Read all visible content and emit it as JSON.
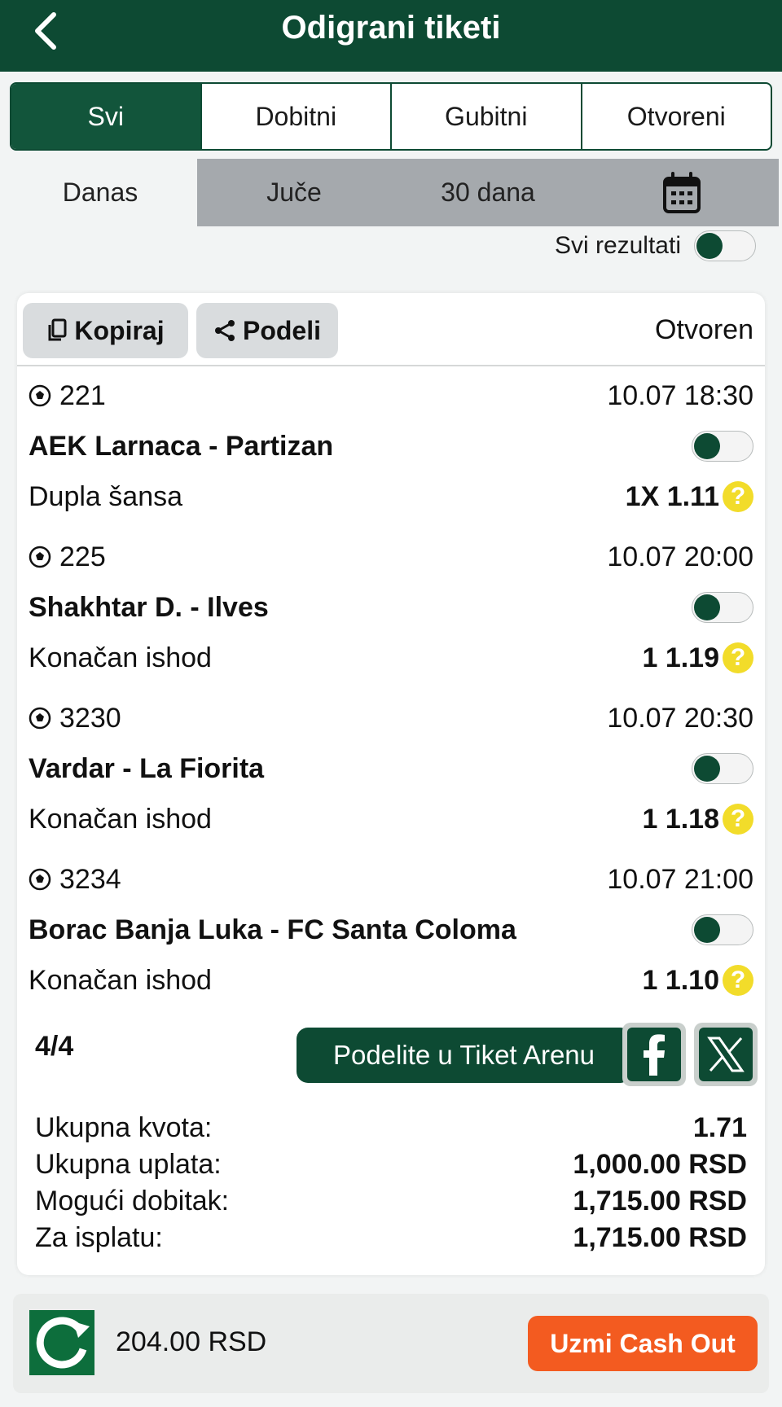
{
  "header": {
    "title": "Odigrani tiketi"
  },
  "tabs": [
    "Svi",
    "Dobitni",
    "Gubitni",
    "Otvoreni"
  ],
  "periods": [
    "Danas",
    "Juče",
    "30 dana"
  ],
  "results_toggle": {
    "label": "Svi rezultati"
  },
  "ticket": {
    "copy_label": "Kopiraj",
    "share_label": "Podeli",
    "status": "Otvoren",
    "matches": [
      {
        "code": "221",
        "datetime": "10.07 18:30",
        "teams": "AEK Larnaca - Partizan",
        "market": "Dupla šansa",
        "pick": "1X 1.11"
      },
      {
        "code": "225",
        "datetime": "10.07 20:00",
        "teams": "Shakhtar D. - Ilves",
        "market": "Konačan ishod",
        "pick": "1 1.19"
      },
      {
        "code": "3230",
        "datetime": "10.07 20:30",
        "teams": "Vardar - La Fiorita",
        "market": "Konačan ishod",
        "pick": "1 1.18"
      },
      {
        "code": "3234",
        "datetime": "10.07 21:00",
        "teams": "Borac Banja Luka - FC Santa Coloma",
        "market": "Konačan ishod",
        "pick": "1 1.10"
      }
    ],
    "count": "4/4",
    "arena_label": "Podelite u Tiket Arenu",
    "totals": [
      {
        "label": "Ukupna kvota:",
        "value": "1.71"
      },
      {
        "label": "Ukupna uplata:",
        "value": "1,000.00 RSD"
      },
      {
        "label": "Mogući dobitak:",
        "value": "1,715.00 RSD"
      },
      {
        "label": "Za isplatu:",
        "value": "1,715.00 RSD"
      }
    ]
  },
  "cashout": {
    "amount": "204.00 RSD",
    "button_label": "Uzmi Cash Out"
  },
  "colors": {
    "brand_green": "#0d4a33",
    "cashout_orange": "#f35b20",
    "help_yellow": "#f2dc2a"
  }
}
